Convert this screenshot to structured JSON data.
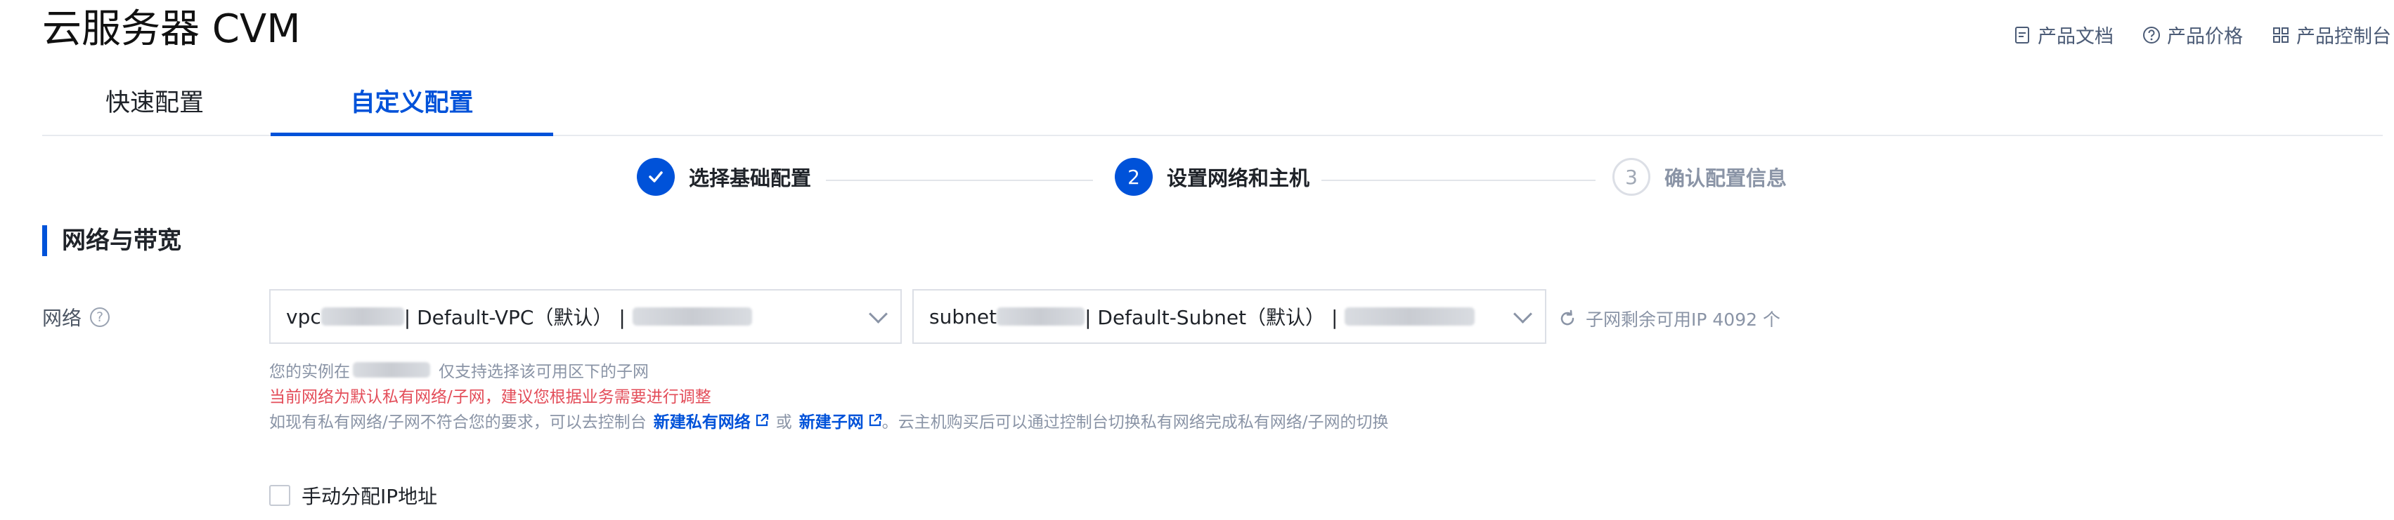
{
  "page": {
    "title": "云服务器 CVM"
  },
  "header_links": [
    {
      "label": "产品文档",
      "icon": "doc-icon"
    },
    {
      "label": "产品价格",
      "icon": "question-circle-icon"
    },
    {
      "label": "产品控制台",
      "icon": "grid-icon"
    }
  ],
  "tabs": [
    {
      "label": "快速配置",
      "active": false
    },
    {
      "label": "自定义配置",
      "active": true
    }
  ],
  "steps": [
    {
      "number": "",
      "label": "选择基础配置",
      "state": "done"
    },
    {
      "number": "2",
      "label": "设置网络和主机",
      "state": "current"
    },
    {
      "number": "3",
      "label": "确认配置信息",
      "state": "pending"
    }
  ],
  "section": {
    "title": "网络与带宽"
  },
  "network": {
    "label": "网络",
    "vpc": {
      "prefix": "vpc",
      "name": "| Default-VPC（默认）  |"
    },
    "subnet": {
      "prefix": "subnet",
      "name": "| Default-Subnet（默认）  |"
    },
    "available_ip_text": "子网剩余可用IP 4092 个"
  },
  "hints": {
    "line1_prefix": "您的实例在",
    "line1_suffix": "仅支持选择该可用区下的子网",
    "line2": "当前网络为默认私有网络/子网，建议您根据业务需要进行调整",
    "line3_prefix": "如现有私有网络/子网不符合您的要求，可以去控制台",
    "link_new_vpc": "新建私有网络",
    "line3_or": "或",
    "link_new_subnet": "新建子网",
    "line3_suffix": "。云主机购买后可以通过控制台切换私有网络完成私有网络/子网的切换"
  },
  "manual_ip": {
    "label": "手动分配IP地址",
    "checked": false
  },
  "colors": {
    "primary": "#0052d9",
    "error": "#e34d59",
    "muted": "#8a94a6"
  }
}
